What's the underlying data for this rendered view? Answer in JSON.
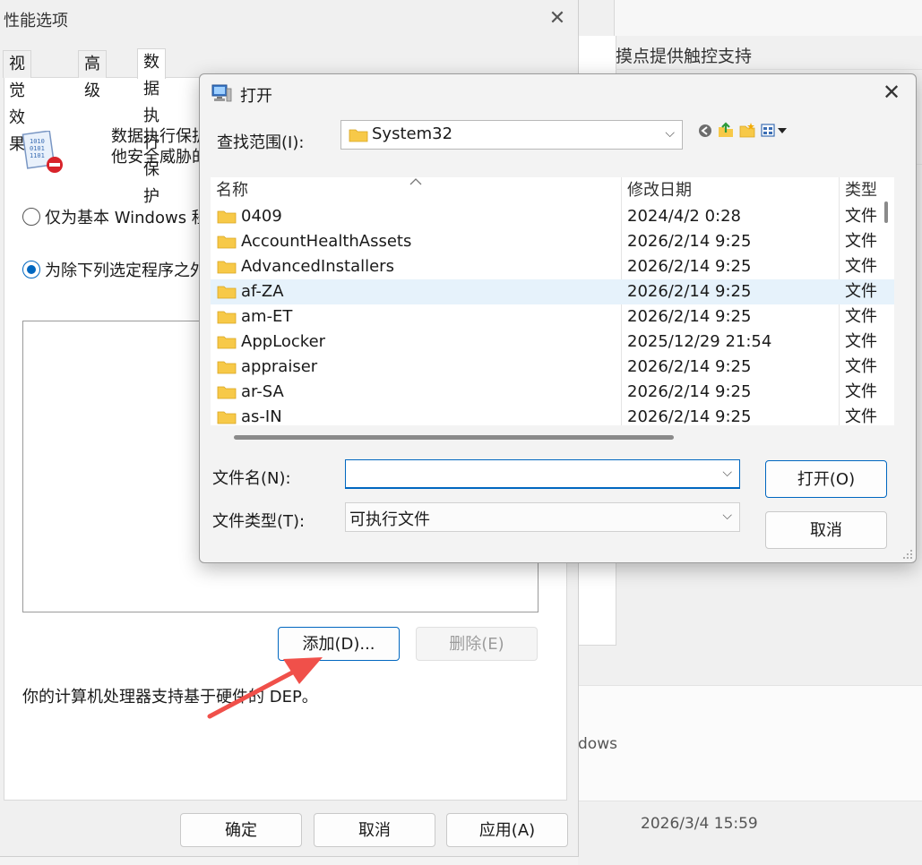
{
  "background_window": {
    "touch_text": "摸点提供触控支持",
    "windows_text": "dows",
    "timestamp": "2026/3/4 15:59"
  },
  "perf_window": {
    "title": "性能选项",
    "close_glyph": "✕",
    "tabs": [
      {
        "label": "视觉效果"
      },
      {
        "label": "高级"
      },
      {
        "label": "数据执行保护"
      }
    ],
    "description_line1": "数据执行保护",
    "description_line2": "他安全威胁的",
    "radio_basic": "仅为基本 Windows 程",
    "radio_all_except": "为除下列选定程序之外",
    "add_button": "添加(D)...",
    "remove_button": "删除(E)",
    "hardware_text": "你的计算机处理器支持基于硬件的 DEP。",
    "ok_button": "确定",
    "cancel_button": "取消",
    "apply_button": "应用(A)"
  },
  "open_dialog": {
    "title": "打开",
    "close_glyph": "✕",
    "look_in_label": "查找范围(I):",
    "look_in_value": "System32",
    "columns": {
      "name": "名称",
      "modified": "修改日期",
      "type": "类型"
    },
    "files": [
      {
        "name": "0409",
        "date": "2024/4/2 0:28",
        "type": "文件"
      },
      {
        "name": "AccountHealthAssets",
        "date": "2026/2/14 9:25",
        "type": "文件"
      },
      {
        "name": "AdvancedInstallers",
        "date": "2026/2/14 9:25",
        "type": "文件"
      },
      {
        "name": "af-ZA",
        "date": "2026/2/14 9:25",
        "type": "文件",
        "selected": true
      },
      {
        "name": "am-ET",
        "date": "2026/2/14 9:25",
        "type": "文件"
      },
      {
        "name": "AppLocker",
        "date": "2025/12/29 21:54",
        "type": "文件"
      },
      {
        "name": "appraiser",
        "date": "2026/2/14 9:25",
        "type": "文件"
      },
      {
        "name": "ar-SA",
        "date": "2026/2/14 9:25",
        "type": "文件"
      },
      {
        "name": "as-IN",
        "date": "2026/2/14 9:25",
        "type": "文件"
      }
    ],
    "filename_label": "文件名(N):",
    "filename_value": "",
    "filetype_label": "文件类型(T):",
    "filetype_value": "可执行文件",
    "open_button": "打开(O)",
    "cancel_button": "取消"
  },
  "colors": {
    "accent": "#0067c0",
    "folder": "#f7c948",
    "selection": "#e6f2fb",
    "arrow": "#f0504a"
  }
}
